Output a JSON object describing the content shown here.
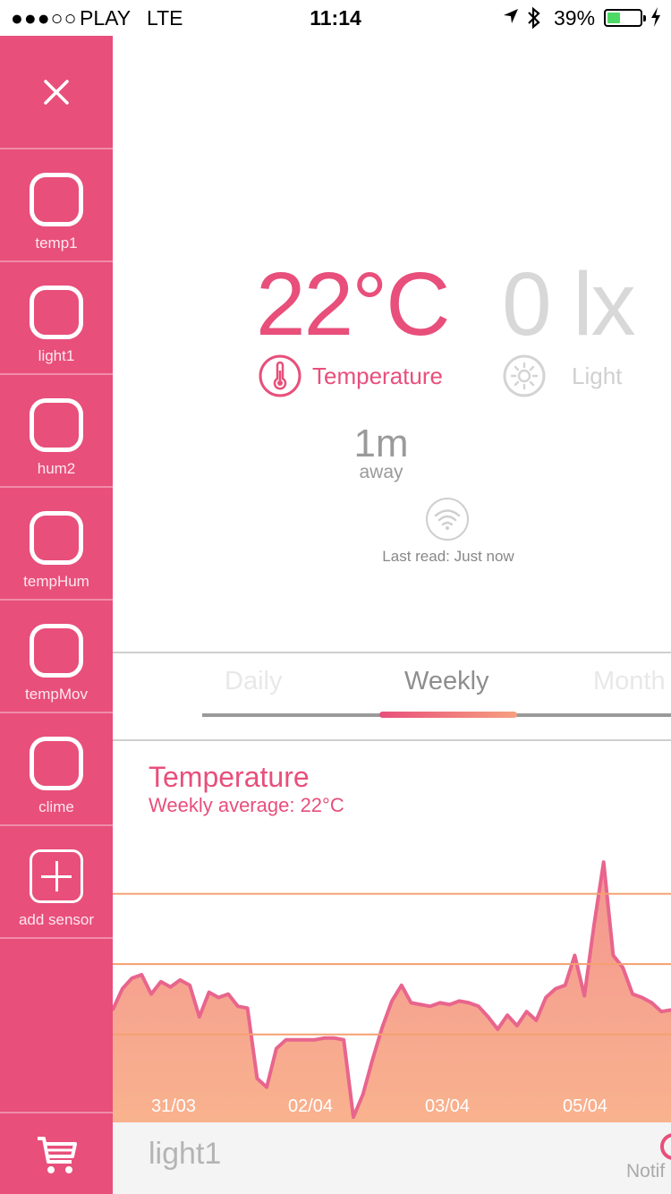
{
  "status_bar": {
    "signal": "●●●○○",
    "carrier": "PLAY",
    "network": "LTE",
    "time": "11:14",
    "battery_percent": "39%",
    "battery_level": 0.39
  },
  "sidebar": {
    "close_icon": "close-icon",
    "sensors": [
      {
        "label": "temp1"
      },
      {
        "label": "light1"
      },
      {
        "label": "hum2"
      },
      {
        "label": "tempHum"
      },
      {
        "label": "tempMov"
      },
      {
        "label": "clime"
      }
    ],
    "add_sensor_label": "add sensor",
    "cart_icon": "cart-icon",
    "color": "#e84f7b"
  },
  "readings": {
    "temperature_value": "22°C",
    "temperature_label": "Temperature",
    "light_value": "0 lx",
    "light_label": "Light",
    "distance_value": "1m",
    "distance_unit": "away",
    "last_read": "Last read: Just now"
  },
  "tabs": [
    {
      "label": "Daily"
    },
    {
      "label": "Weekly"
    },
    {
      "label": "Month"
    }
  ],
  "active_tab": "Weekly",
  "chart_data": {
    "type": "area",
    "title": "Temperature",
    "subtitle": "Weekly average: 22°C",
    "x_tick_labels": [
      "31/03",
      "02/04",
      "03/04",
      "05/04"
    ],
    "ylim": [
      14,
      31
    ],
    "reference_lines": [
      27,
      23,
      19
    ],
    "values": [
      20.4,
      21.6,
      22.2,
      22.4,
      21.3,
      22.0,
      21.7,
      22.1,
      21.8,
      20.0,
      21.4,
      21.1,
      21.3,
      20.6,
      20.5,
      16.5,
      16.0,
      18.2,
      18.7,
      18.7,
      18.7,
      18.7,
      18.8,
      18.8,
      18.7,
      14.3,
      15.6,
      17.6,
      19.4,
      20.9,
      21.8,
      20.8,
      20.7,
      20.6,
      20.8,
      20.7,
      20.9,
      20.8,
      20.6,
      20.0,
      19.3,
      20.1,
      19.5,
      20.3,
      19.8,
      21.1,
      21.6,
      21.8,
      23.5,
      21.2,
      25.2,
      28.8,
      23.5,
      22.8,
      21.3,
      21.1,
      20.8,
      20.3,
      20.4
    ],
    "colors": {
      "line": "#e8658d",
      "fill_top": "#f39690",
      "fill_bottom": "#f9b28e",
      "reference": "#f5a070"
    }
  },
  "bottom_bar": {
    "sensor_name": "light1",
    "notifications_label": "Notif"
  }
}
